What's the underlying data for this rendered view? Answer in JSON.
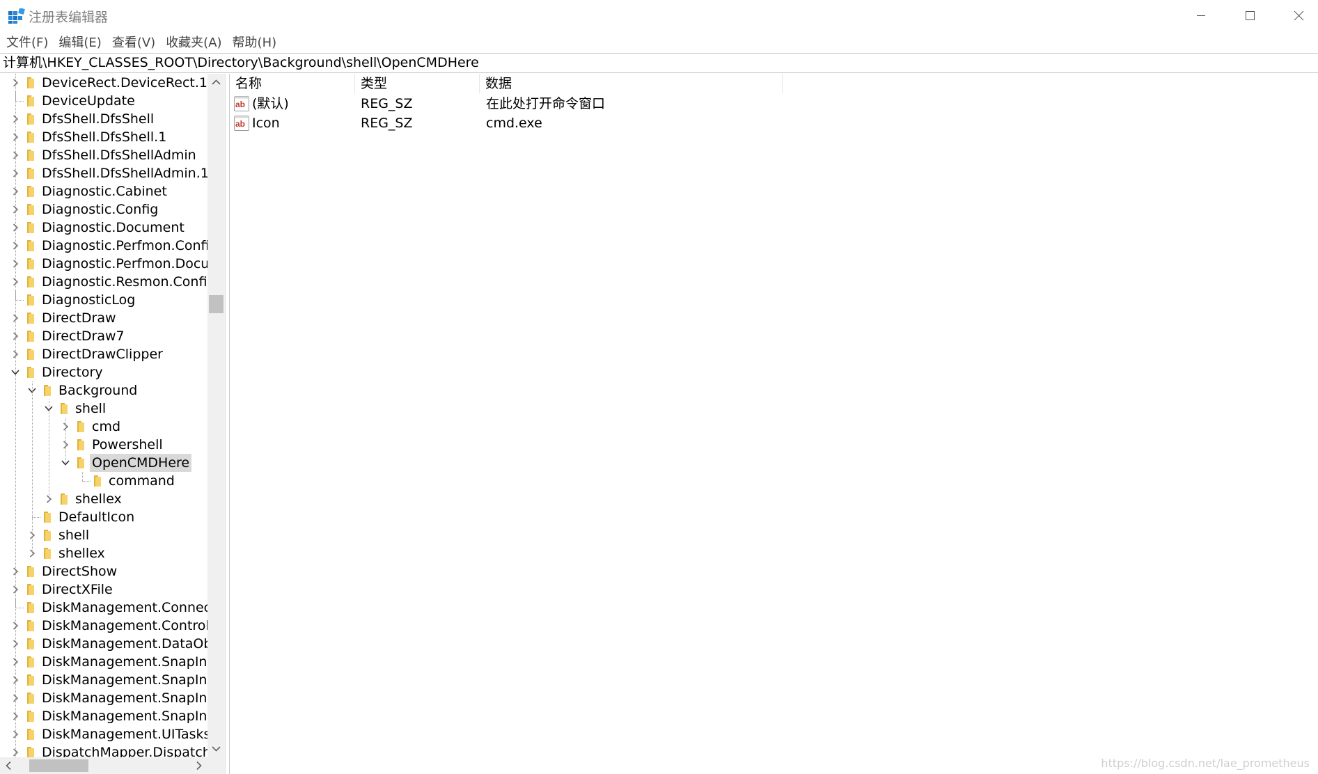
{
  "window": {
    "title": "注册表编辑器"
  },
  "menu": [
    "文件(F)",
    "编辑(E)",
    "查看(V)",
    "收藏夹(A)",
    "帮助(H)"
  ],
  "address": "计算机\\HKEY_CLASSES_ROOT\\Directory\\Background\\shell\\OpenCMDHere",
  "tree": [
    {
      "label": "DeviceRect.DeviceRect.1",
      "depth": 0,
      "expander": "collapsed"
    },
    {
      "label": "DeviceUpdate",
      "depth": 0,
      "expander": "none"
    },
    {
      "label": "DfsShell.DfsShell",
      "depth": 0,
      "expander": "collapsed"
    },
    {
      "label": "DfsShell.DfsShell.1",
      "depth": 0,
      "expander": "collapsed"
    },
    {
      "label": "DfsShell.DfsShellAdmin",
      "depth": 0,
      "expander": "collapsed"
    },
    {
      "label": "DfsShell.DfsShellAdmin.1",
      "depth": 0,
      "expander": "collapsed"
    },
    {
      "label": "Diagnostic.Cabinet",
      "depth": 0,
      "expander": "collapsed"
    },
    {
      "label": "Diagnostic.Config",
      "depth": 0,
      "expander": "collapsed"
    },
    {
      "label": "Diagnostic.Document",
      "depth": 0,
      "expander": "collapsed"
    },
    {
      "label": "Diagnostic.Perfmon.Config",
      "depth": 0,
      "expander": "collapsed"
    },
    {
      "label": "Diagnostic.Perfmon.Docum",
      "depth": 0,
      "expander": "collapsed"
    },
    {
      "label": "Diagnostic.Resmon.Config",
      "depth": 0,
      "expander": "collapsed"
    },
    {
      "label": "DiagnosticLog",
      "depth": 0,
      "expander": "none"
    },
    {
      "label": "DirectDraw",
      "depth": 0,
      "expander": "collapsed"
    },
    {
      "label": "DirectDraw7",
      "depth": 0,
      "expander": "collapsed"
    },
    {
      "label": "DirectDrawClipper",
      "depth": 0,
      "expander": "collapsed"
    },
    {
      "label": "Directory",
      "depth": 0,
      "expander": "expanded"
    },
    {
      "label": "Background",
      "depth": 1,
      "expander": "expanded"
    },
    {
      "label": "shell",
      "depth": 2,
      "expander": "expanded"
    },
    {
      "label": "cmd",
      "depth": 3,
      "expander": "collapsed"
    },
    {
      "label": "Powershell",
      "depth": 3,
      "expander": "collapsed"
    },
    {
      "label": "OpenCMDHere",
      "depth": 3,
      "expander": "expanded",
      "selected": true
    },
    {
      "label": "command",
      "depth": 4,
      "expander": "none"
    },
    {
      "label": "shellex",
      "depth": 2,
      "expander": "collapsed"
    },
    {
      "label": "DefaultIcon",
      "depth": 1,
      "expander": "none"
    },
    {
      "label": "shell",
      "depth": 1,
      "expander": "collapsed"
    },
    {
      "label": "shellex",
      "depth": 1,
      "expander": "collapsed"
    },
    {
      "label": "DirectShow",
      "depth": 0,
      "expander": "collapsed"
    },
    {
      "label": "DirectXFile",
      "depth": 0,
      "expander": "collapsed"
    },
    {
      "label": "DiskManagement.Connecti",
      "depth": 0,
      "expander": "none"
    },
    {
      "label": "DiskManagement.Control",
      "depth": 0,
      "expander": "collapsed"
    },
    {
      "label": "DiskManagement.DataObje",
      "depth": 0,
      "expander": "collapsed"
    },
    {
      "label": "DiskManagement.SnapIn",
      "depth": 0,
      "expander": "collapsed"
    },
    {
      "label": "DiskManagement.SnapInAb",
      "depth": 0,
      "expander": "collapsed"
    },
    {
      "label": "DiskManagement.SnapInCo",
      "depth": 0,
      "expander": "collapsed"
    },
    {
      "label": "DiskManagement.SnapInEx",
      "depth": 0,
      "expander": "collapsed"
    },
    {
      "label": "DiskManagement.UITasks",
      "depth": 0,
      "expander": "collapsed"
    },
    {
      "label": "DispatchMapper.DispatchM",
      "depth": 0,
      "expander": "collapsed"
    }
  ],
  "values": {
    "columns": [
      "名称",
      "类型",
      "数据"
    ],
    "rows": [
      {
        "name": "(默认)",
        "type": "REG_SZ",
        "data": "在此处打开命令窗口",
        "icon": "string-value-icon"
      },
      {
        "name": "Icon",
        "type": "REG_SZ",
        "data": "cmd.exe",
        "icon": "string-value-icon"
      }
    ]
  },
  "watermark": "https://blog.csdn.net/lae_prometheus",
  "colors": {
    "folder": "#f6d26a",
    "folder_dark": "#e0b33a",
    "selection": "#d9d9d9",
    "ab_icon": "#c0392b"
  }
}
